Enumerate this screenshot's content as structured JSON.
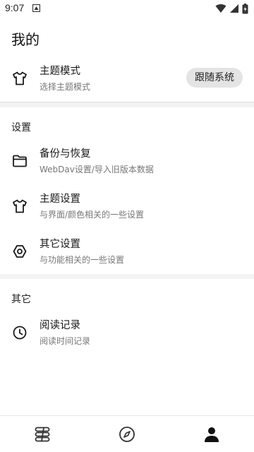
{
  "status_bar": {
    "time": "9:07"
  },
  "page": {
    "title": "我的"
  },
  "theme_mode_row": {
    "title": "主题模式",
    "subtitle": "选择主题模式",
    "chip_label": "跟随系统",
    "icon": "tshirt-icon"
  },
  "settings_section": {
    "header": "设置",
    "items": [
      {
        "title": "备份与恢复",
        "subtitle": "WebDav设置/导入旧版本数据",
        "icon": "folder-icon"
      },
      {
        "title": "主题设置",
        "subtitle": "与界面/颜色相关的一些设置",
        "icon": "tshirt-icon"
      },
      {
        "title": "其它设置",
        "subtitle": "与功能相关的一些设置",
        "icon": "hexagon-settings-icon"
      }
    ]
  },
  "other_section": {
    "header": "其它",
    "items": [
      {
        "title": "阅读记录",
        "subtitle": "阅读时间记录",
        "icon": "clock-icon"
      }
    ]
  },
  "bottom_nav": {
    "items": [
      {
        "icon": "bookshelf-icon",
        "active": false
      },
      {
        "icon": "compass-icon",
        "active": false
      },
      {
        "icon": "person-icon",
        "active": true
      }
    ]
  },
  "colors": {
    "background": "#ffffff",
    "band": "#f3f3f3",
    "chip": "#e4e4e4",
    "subtitle": "#777777",
    "icon": "#1a1a1a"
  }
}
